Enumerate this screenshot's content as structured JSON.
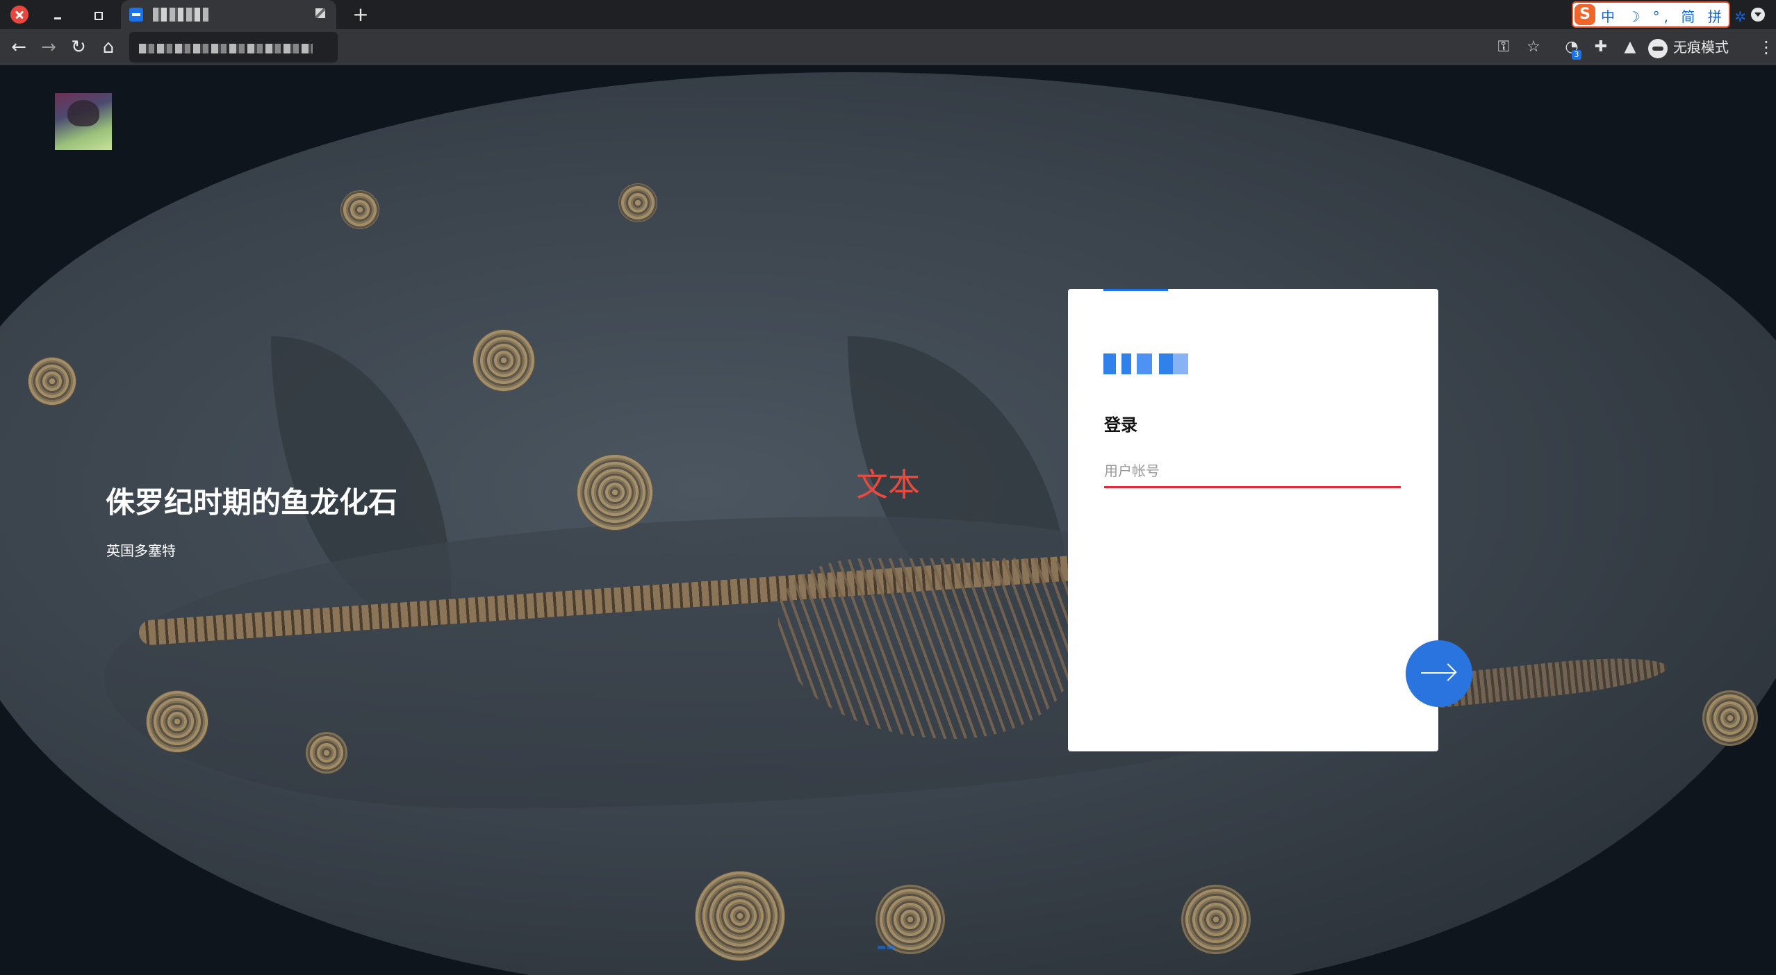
{
  "browser": {
    "new_tab_label": "+",
    "ime": {
      "logo": "S",
      "items": "中 ☽ °, 简 拼 ✲"
    },
    "toolbar": {
      "back_icon": "←",
      "forward_icon": "→",
      "reload_icon": "↻",
      "home_icon": "⌂",
      "key_icon": "⚿",
      "star_icon": "☆",
      "extension_badge": "3",
      "puzzle_icon": "✚",
      "lab_icon": "▲",
      "incognito_label": "无痕模式",
      "menu_icon": "⋮"
    }
  },
  "page": {
    "caption_title": "侏罗纪时期的鱼龙化石",
    "caption_subtitle": "英国多塞特",
    "overlay_text": "文本",
    "login": {
      "heading": "登录",
      "username_placeholder": "用户帐号",
      "username_value": ""
    }
  },
  "colors": {
    "accent": "#1a73e8",
    "input_underline": "#e22b3a",
    "overlay_text": "#e84a3f"
  }
}
